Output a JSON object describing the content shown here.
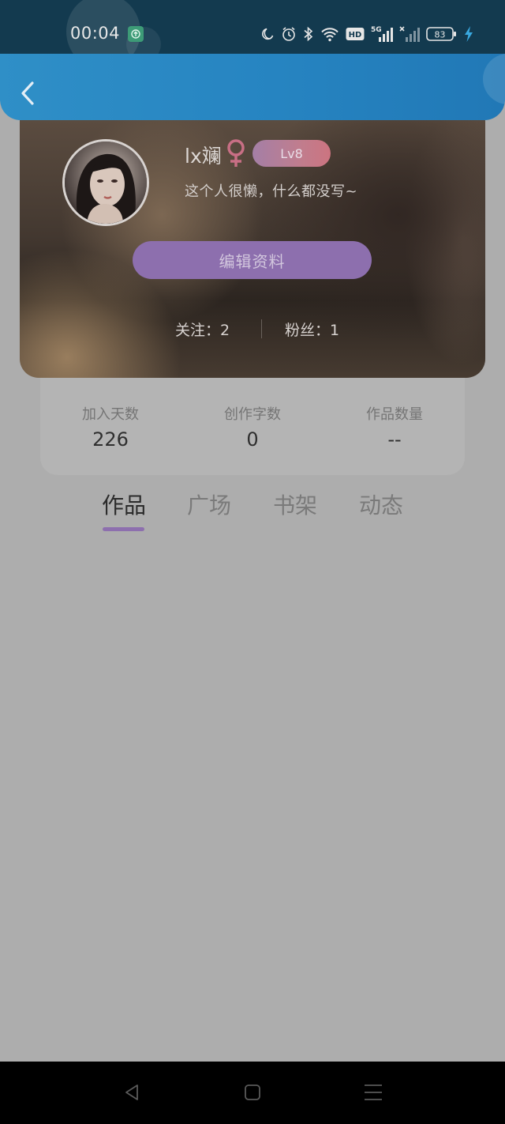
{
  "status_bar": {
    "time": "00:04",
    "battery": "83",
    "icons": [
      "upload-app-icon",
      "moon-icon",
      "alarm-icon",
      "bluetooth-icon",
      "wifi-icon",
      "hd-icon",
      "signal-5g-icon",
      "signal-x-icon",
      "battery-icon",
      "charging-icon"
    ],
    "hd_label": "HD",
    "network_label": "5G"
  },
  "header": {
    "back_icon": "chevron-left-icon"
  },
  "profile": {
    "username": "lx斓",
    "gender": "female",
    "level": "Lv8",
    "bio": "这个人很懒，什么都没写~",
    "edit_button": "编辑资料",
    "follow": "关注：2",
    "fans": "粉丝：1"
  },
  "stats": [
    {
      "label": "加入天数",
      "value": "226"
    },
    {
      "label": "创作字数",
      "value": "0"
    },
    {
      "label": "作品数量",
      "value": "--"
    }
  ],
  "tabs": [
    {
      "label": "作品",
      "active": true
    },
    {
      "label": "广场",
      "active": false
    },
    {
      "label": "书架",
      "active": false
    },
    {
      "label": "动态",
      "active": false
    }
  ],
  "nav_bar": {
    "buttons": [
      "back-triangle-icon",
      "home-square-icon",
      "menu-lines-icon"
    ]
  },
  "colors": {
    "accent": "#8d6fae",
    "header_blue": "#2684c1",
    "background": "#adadad"
  }
}
